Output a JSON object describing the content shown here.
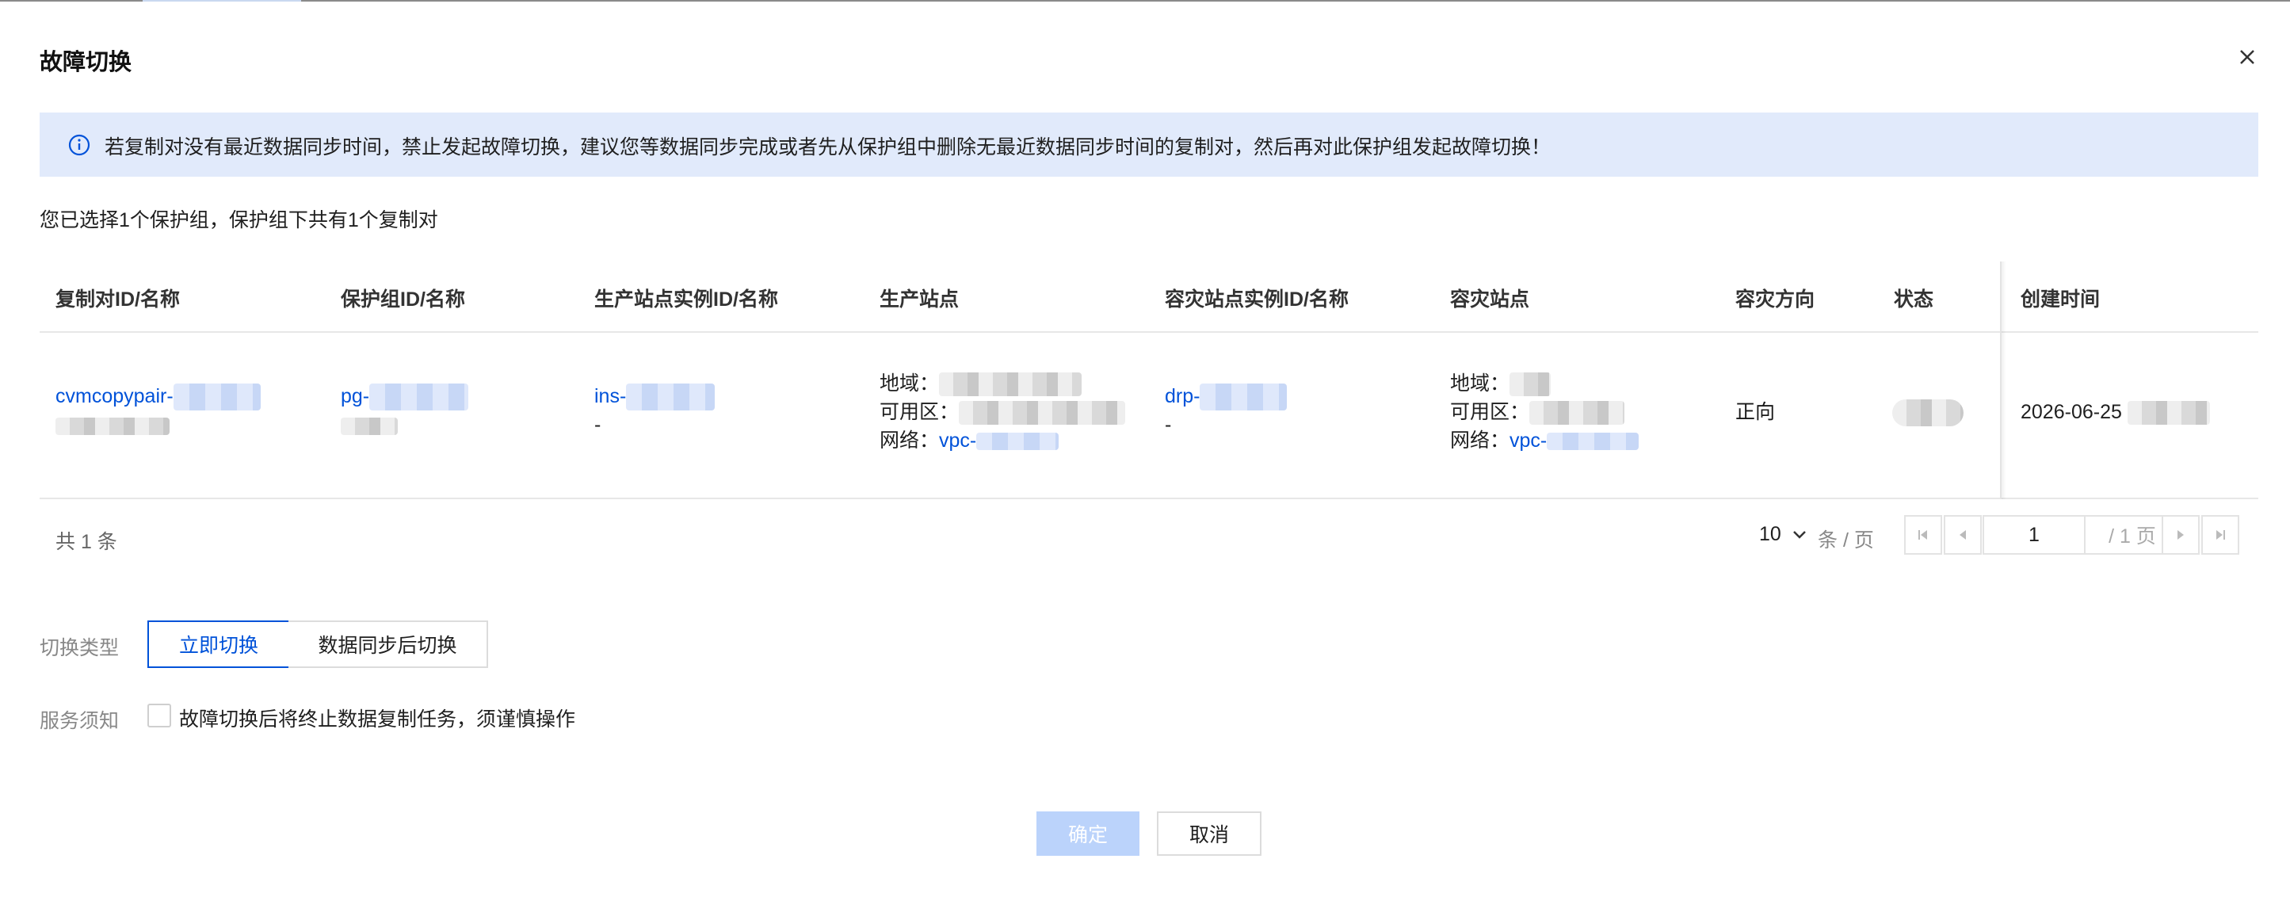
{
  "dialog": {
    "title": "故障切换"
  },
  "notice": {
    "text": "若复制对没有最近数据同步时间，禁止发起故障切换，建议您等数据同步完成或者先从保护组中删除无最近数据同步时间的复制对，然后再对此保护组发起故障切换！"
  },
  "summary": "您已选择1个保护组，保护组下共有1个复制对",
  "table": {
    "headers": [
      "复制对ID/名称",
      "保护组ID/名称",
      "生产站点实例ID/名称",
      "生产站点",
      "容灾站点实例ID/名称",
      "容灾站点",
      "容灾方向",
      "状态",
      "创建时间"
    ],
    "rows": [
      {
        "pair_id": "cvmcopypair-",
        "group_id": "pg-",
        "prod_instance_id": "ins-",
        "prod_instance_name": "-",
        "prod_site": {
          "region_label": "地域：",
          "zone_label": "可用区：",
          "network_label": "网络：",
          "network_value": "vpc-"
        },
        "dr_instance_id": "drp-",
        "dr_instance_name": "-",
        "dr_site": {
          "region_label": "地域：",
          "zone_label": "可用区：",
          "network_label": "网络：",
          "network_value": "vpc-"
        },
        "direction": "正向",
        "created": "2026-06-25"
      }
    ]
  },
  "pagination": {
    "total": "共 1 条",
    "page_size": "10",
    "per_page_label": "条 / 页",
    "current_page": "1",
    "total_pages": "/ 1 页"
  },
  "form": {
    "switch_type_label": "切换类型",
    "options": [
      "立即切换",
      "数据同步后切换"
    ],
    "selected": "立即切换",
    "notice_label": "服务须知",
    "agreement_text": "故障切换后将终止数据复制任务，须谨慎操作",
    "agreement_checked": false
  },
  "buttons": {
    "confirm": "确定",
    "cancel": "取消"
  },
  "colors": {
    "primary": "#0052d9",
    "notice_bg": "#e1eafb",
    "disabled_primary": "#bbd3fb"
  }
}
